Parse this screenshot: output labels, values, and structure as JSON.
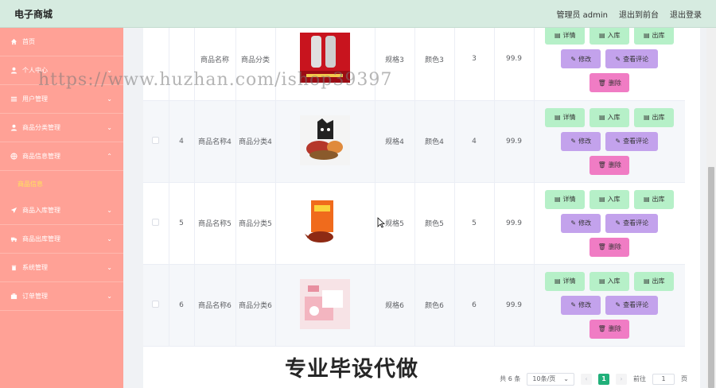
{
  "app": {
    "title": "电子商城"
  },
  "header": {
    "user": "管理员 admin",
    "front": "退出到前台",
    "logout": "退出登录"
  },
  "sidebar": {
    "items": [
      {
        "label": "首页",
        "icon": "home-icon",
        "expanded": false
      },
      {
        "label": "个人中心",
        "icon": "user-icon",
        "expanded": false
      },
      {
        "label": "用户管理",
        "icon": "list-icon",
        "expanded": false
      },
      {
        "label": "商品分类管理",
        "icon": "user-icon",
        "expanded": false
      },
      {
        "label": "商品信息管理",
        "icon": "globe-icon",
        "expanded": true
      },
      {
        "label": "商品入库管理",
        "icon": "send-icon",
        "expanded": false
      },
      {
        "label": "商品出库管理",
        "icon": "truck-icon",
        "expanded": false
      },
      {
        "label": "系统管理",
        "icon": "trash-icon",
        "expanded": false
      },
      {
        "label": "订单管理",
        "icon": "briefcase-icon",
        "expanded": false
      }
    ],
    "active_sub": "商品信息"
  },
  "table": {
    "rows": [
      {
        "id": "",
        "name": "商品名称",
        "category": "商品分类",
        "spec": "规格3",
        "color": "颜色3",
        "stock": "3",
        "price": "99.9",
        "image": "red-poster"
      },
      {
        "id": "4",
        "name": "商品名称4",
        "category": "商品分类4",
        "spec": "规格4",
        "color": "颜色4",
        "stock": "4",
        "price": "99.9",
        "image": "cat-snacks"
      },
      {
        "id": "5",
        "name": "商品名称5",
        "category": "商品分类5",
        "spec": "规格5",
        "color": "颜色5",
        "stock": "5",
        "price": "99.9",
        "image": "roast-duck"
      },
      {
        "id": "6",
        "name": "商品名称6",
        "category": "商品分类6",
        "spec": "规格6",
        "color": "颜色6",
        "stock": "6",
        "price": "99.9",
        "image": "pink-gift"
      }
    ],
    "actions": {
      "detail": "详情",
      "stock_in": "入库",
      "stock_out": "出库",
      "edit": "修改",
      "review": "查看评论",
      "delete": "删除"
    }
  },
  "pagination": {
    "total": "共 6 条",
    "page_size": "10条/页",
    "current": "1",
    "goto": "前往",
    "goto_value": "1",
    "page_unit": "页"
  },
  "watermark": {
    "url": "https://www.huzhan.com/ishop39397",
    "slogan": "专业毕设代做"
  },
  "colors": {
    "sidebar": "#ffa196",
    "header": "#d6ebe0",
    "btn_green": "#b6f0c8",
    "btn_purple": "#c3a2ec",
    "btn_pink": "#f07cc4",
    "page_current": "#21b07a"
  }
}
